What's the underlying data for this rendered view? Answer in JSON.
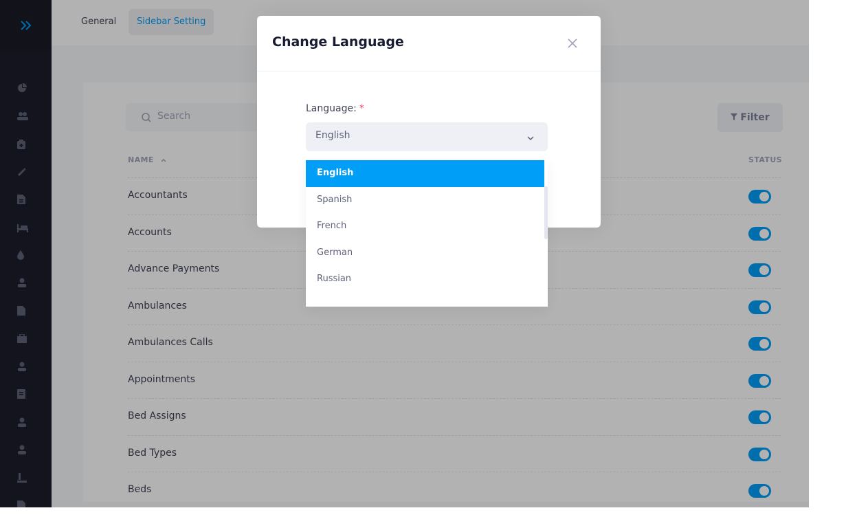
{
  "tabs": [
    {
      "label": "General"
    },
    {
      "label": "Sidebar Setting"
    }
  ],
  "search": {
    "placeholder": "Search"
  },
  "filter": {
    "label": "Filter"
  },
  "table": {
    "columns": {
      "name": "NAME",
      "status": "STATUS"
    },
    "rows": [
      {
        "name": "Accountants"
      },
      {
        "name": "Accounts"
      },
      {
        "name": "Advance Payments"
      },
      {
        "name": "Ambulances"
      },
      {
        "name": "Ambulances Calls"
      },
      {
        "name": "Appointments"
      },
      {
        "name": "Bed Assigns"
      },
      {
        "name": "Bed Types"
      },
      {
        "name": "Beds"
      }
    ]
  },
  "modal": {
    "title": "Change Language",
    "field_label": "Language:",
    "required_mark": "*",
    "selected_value": "English",
    "options": [
      "English",
      "Spanish",
      "French",
      "German",
      "Russian"
    ]
  },
  "colors": {
    "accent": "#009ef7",
    "sidebar": "#1e1e2d",
    "required": "#f1416c"
  },
  "icons": {
    "sidebar": [
      "dashboard-icon",
      "users-icon",
      "clipboard-icon",
      "syringe-icon",
      "report-icon",
      "bed-icon",
      "blood-drop-icon",
      "doctor-icon",
      "document-icon",
      "briefcase-icon",
      "nurse-icon",
      "notes-icon",
      "medical-staff-icon",
      "patient-icon",
      "pharmacy-icon",
      "file-icon"
    ]
  }
}
